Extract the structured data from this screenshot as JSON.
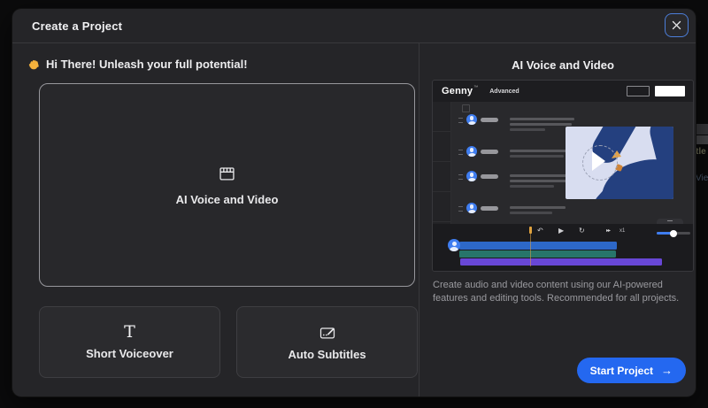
{
  "modal": {
    "title": "Create a Project",
    "close_icon": "✕"
  },
  "left": {
    "greeting_emoji": "👋",
    "greeting": "Hi There! Unleash your full potential!",
    "primary_card": {
      "label": "AI Voice and Video",
      "icon": "clapperboard-icon"
    },
    "cards": [
      {
        "label": "Short Voiceover",
        "icon": "serif-T-icon",
        "icon_glyph": "T"
      },
      {
        "label": "Auto Subtitles",
        "icon": "subtitles-edit-icon"
      }
    ]
  },
  "right": {
    "heading": "AI Voice and Video",
    "preview": {
      "logo": "Genny",
      "logo_mark": "™",
      "plan_label": "Advanced",
      "speed_label": "x1",
      "icons": {
        "undo": "↶",
        "play": "▶",
        "loop": "↻",
        "fast_forward": "▸▸"
      }
    },
    "description": "Create audio and video content using our AI-powered features and editing tools. Recommended for all projects.",
    "start_button": {
      "label": "Start Project",
      "arrow": "→"
    }
  },
  "background": {
    "fragments": [
      "tle",
      "Vie"
    ]
  },
  "colors": {
    "accent_blue": "#2468F0",
    "close_focus_blue": "#4C7ED9",
    "track_blue": "#2D68C8",
    "track_teal": "#27756A",
    "track_purple": "#6847D6",
    "playhead_orange": "#E0A23E",
    "avatar_blue": "#3F7DF0",
    "video_bg": "#D8DDF0",
    "hand_navy": "#24407F",
    "modal_bg": "#252528",
    "page_bg": "#0B0B0C"
  }
}
